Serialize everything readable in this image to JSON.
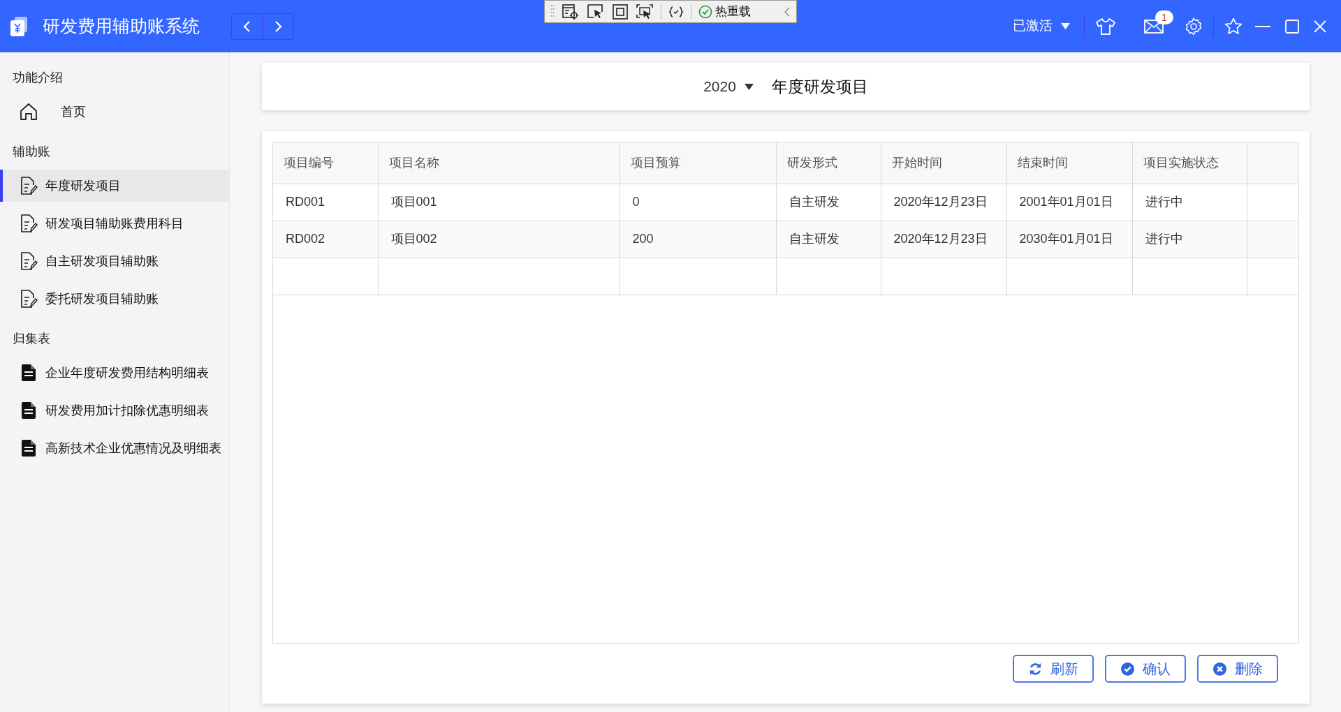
{
  "app": {
    "title": "研发费用辅助账系统",
    "debug_toolbar": {
      "label": "热重载"
    },
    "license": "已激活",
    "mail_badge": "1"
  },
  "sidebar": [
    {
      "title": "功能介绍",
      "items": [
        {
          "label": "首页",
          "kind": "home",
          "selected": false
        }
      ]
    },
    {
      "title": "辅助账",
      "items": [
        {
          "label": "年度研发项目",
          "kind": "edit",
          "selected": true
        },
        {
          "label": "研发项目辅助账费用科目",
          "kind": "edit",
          "selected": false
        },
        {
          "label": "自主研发项目辅助账",
          "kind": "edit",
          "selected": false
        },
        {
          "label": "委托研发项目辅助账",
          "kind": "edit",
          "selected": false
        }
      ]
    },
    {
      "title": "归集表",
      "items": [
        {
          "label": "企业年度研发费用结构明细表",
          "kind": "report",
          "selected": false
        },
        {
          "label": "研发费用加计扣除优惠明细表",
          "kind": "report",
          "selected": false
        },
        {
          "label": "高新技术企业优惠情况及明细表",
          "kind": "report",
          "selected": false
        }
      ]
    }
  ],
  "header": {
    "year": "2020",
    "title": "年度研发项目"
  },
  "table": {
    "columns": [
      "项目编号",
      "项目名称",
      "项目预算",
      "研发形式",
      "开始时间",
      "结束时间",
      "项目实施状态"
    ],
    "rows": [
      [
        "RD001",
        "项目001",
        "0",
        "自主研发",
        "2020年12月23日",
        "2001年01月01日",
        "进行中"
      ],
      [
        "RD002",
        "项目002",
        "200",
        "自主研发",
        "2020年12月23日",
        "2030年01月01日",
        "进行中"
      ]
    ]
  },
  "buttons": [
    {
      "label": "刷新",
      "kind": "refresh"
    },
    {
      "label": "确认",
      "kind": "confirm"
    },
    {
      "label": "删除",
      "kind": "delete"
    }
  ]
}
